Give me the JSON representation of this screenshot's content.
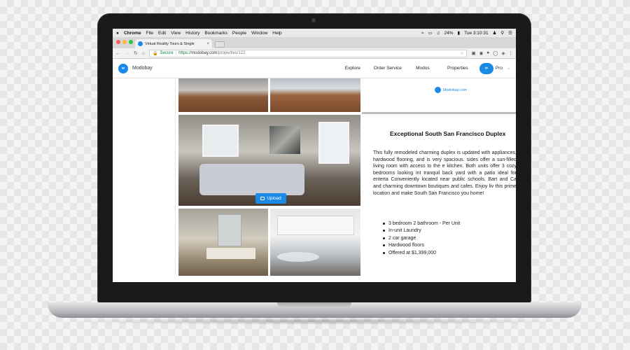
{
  "menubar": {
    "apple": "",
    "items": [
      "Chrome",
      "File",
      "Edit",
      "View",
      "History",
      "Bookmarks",
      "People",
      "Window",
      "Help"
    ],
    "battery": "24%",
    "clock": "Tue 3:10:31"
  },
  "browser": {
    "tab_title": "Virtual Reality Tours & Single",
    "tab_close": "×",
    "secure_label": "Secure",
    "url_scheme": "https://",
    "url_host": "modobay.com",
    "url_path": "/properties/122"
  },
  "site": {
    "brand": "Modobay",
    "nav": [
      "Explore",
      "Order Service",
      "Modos",
      "Properties"
    ],
    "account_label": "Pro"
  },
  "gallery": {
    "upload_label": "Upload"
  },
  "listing": {
    "watermark": "Modobay.com",
    "title": "Exceptional South San Francisco Duplex",
    "description": "This fully remodeled charming duplex is updated with appliances, hardwood flooring, and is very spacious. sides offer a sun-filled living room with access to the e kitchen. Both units offer 3 cozy bedrooms looking int tranquil back yard with a patio ideal for enterta Conveniently located near public schools, Bart and Ca and charming downtown boutiques and cafes. Enjoy liv this prime location and make South San Francisco you home!",
    "features": [
      "3 bedroom 2 bathroom - Per Unit",
      "In-unit Laundry",
      "2 car garage",
      "Hardwood floors",
      "Offered at $1,399,000"
    ]
  },
  "colors": {
    "accent": "#1a8ae6",
    "secure": "#0b8043"
  }
}
